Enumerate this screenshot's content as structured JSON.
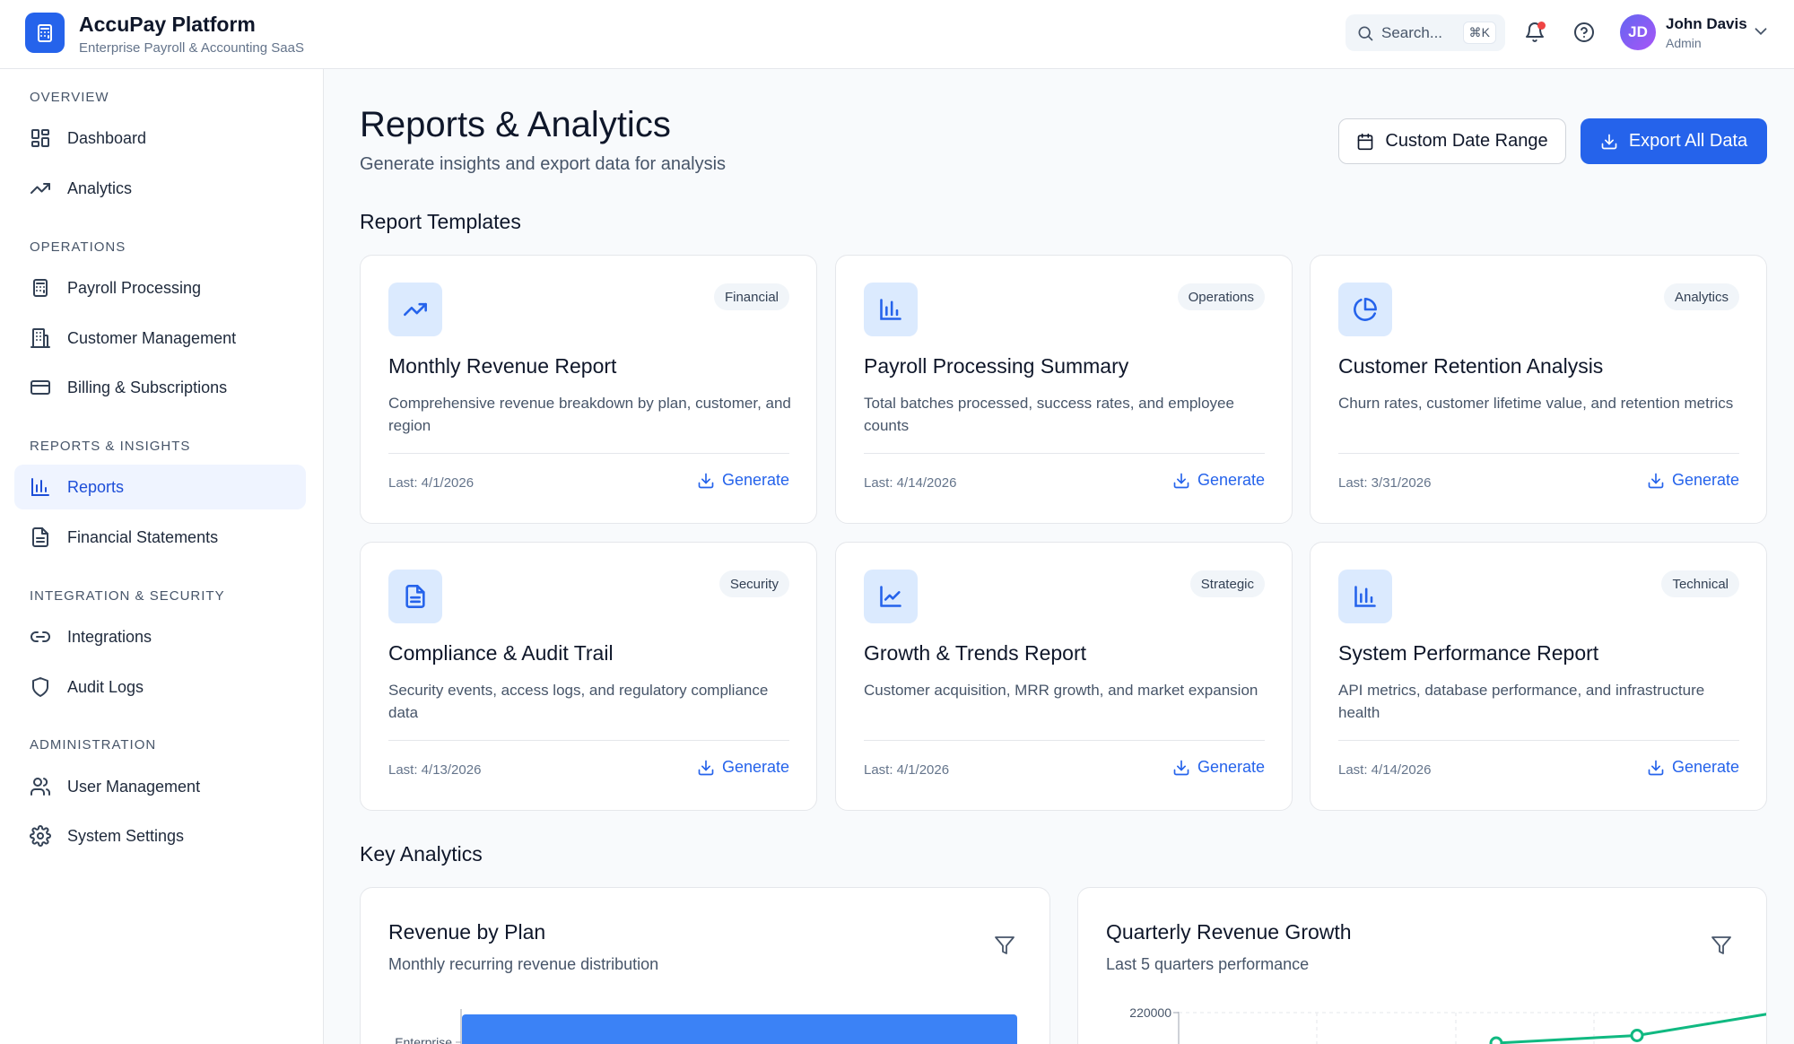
{
  "app": {
    "title": "AccuPay Platform",
    "subtitle": "Enterprise Payroll & Accounting SaaS"
  },
  "topbar": {
    "search_label": "Search...",
    "search_shortcut": "⌘K",
    "user_initials": "JD",
    "user_name": "John Davis",
    "user_role": "Admin"
  },
  "sidebar": {
    "sections": [
      {
        "label": "OVERVIEW",
        "items": [
          {
            "label": "Dashboard",
            "icon": "dashboard-icon"
          },
          {
            "label": "Analytics",
            "icon": "trending-up-icon"
          }
        ]
      },
      {
        "label": "OPERATIONS",
        "items": [
          {
            "label": "Payroll Processing",
            "icon": "calculator-icon"
          },
          {
            "label": "Customer Management",
            "icon": "building-icon"
          },
          {
            "label": "Billing & Subscriptions",
            "icon": "credit-card-icon"
          }
        ]
      },
      {
        "label": "REPORTS & INSIGHTS",
        "items": [
          {
            "label": "Reports",
            "icon": "bar-chart-icon",
            "active": true
          },
          {
            "label": "Financial Statements",
            "icon": "document-icon"
          }
        ]
      },
      {
        "label": "INTEGRATION & SECURITY",
        "items": [
          {
            "label": "Integrations",
            "icon": "link-icon"
          },
          {
            "label": "Audit Logs",
            "icon": "shield-icon"
          }
        ]
      },
      {
        "label": "ADMINISTRATION",
        "items": [
          {
            "label": "User Management",
            "icon": "users-icon"
          },
          {
            "label": "System Settings",
            "icon": "gear-icon"
          }
        ]
      }
    ]
  },
  "page": {
    "title": "Reports & Analytics",
    "subtitle": "Generate insights and export data for analysis",
    "custom_date_label": "Custom Date Range",
    "export_label": "Export All Data"
  },
  "templates": {
    "section_title": "Report Templates",
    "generate_label": "Generate",
    "items": [
      {
        "title": "Monthly Revenue Report",
        "badge": "Financial",
        "desc": "Comprehensive revenue breakdown by plan, customer, and region",
        "last": "Last: 4/1/2026",
        "icon": "trending-up-icon"
      },
      {
        "title": "Payroll Processing Summary",
        "badge": "Operations",
        "desc": "Total batches processed, success rates, and employee counts",
        "last": "Last: 4/14/2026",
        "icon": "bar-chart-icon"
      },
      {
        "title": "Customer Retention Analysis",
        "badge": "Analytics",
        "desc": "Churn rates, customer lifetime value, and retention metrics",
        "last": "Last: 3/31/2026",
        "icon": "pie-chart-icon"
      },
      {
        "title": "Compliance & Audit Trail",
        "badge": "Security",
        "desc": "Security events, access logs, and regulatory compliance data",
        "last": "Last: 4/13/2026",
        "icon": "document-icon"
      },
      {
        "title": "Growth & Trends Report",
        "badge": "Strategic",
        "desc": "Customer acquisition, MRR growth, and market expansion",
        "last": "Last: 4/1/2026",
        "icon": "line-chart-icon"
      },
      {
        "title": "System Performance Report",
        "badge": "Technical",
        "desc": "API metrics, database performance, and infrastructure health",
        "last": "Last: 4/14/2026",
        "icon": "bar-chart-icon"
      }
    ]
  },
  "analytics": {
    "section_title": "Key Analytics",
    "revenue_by_plan": {
      "title": "Revenue by Plan",
      "subtitle": "Monthly recurring revenue distribution"
    },
    "quarterly_growth": {
      "title": "Quarterly Revenue Growth",
      "subtitle": "Last 5 quarters performance"
    }
  },
  "colors": {
    "primary": "#2563eb",
    "bar": "#3b82f6",
    "line": "#10b981",
    "notification": "#ef4444"
  },
  "chart_data": [
    {
      "type": "bar",
      "orientation": "horizontal",
      "categories": [
        "Enterprise"
      ],
      "note_visible": "chart is cut off at the bottom of the viewport; only the first category is visible"
    },
    {
      "type": "line",
      "y_tick_labels": [
        "220000"
      ],
      "series": [
        {
          "values_visible_partial": [
            200000,
            205000,
            220000
          ]
        }
      ]
    }
  ]
}
